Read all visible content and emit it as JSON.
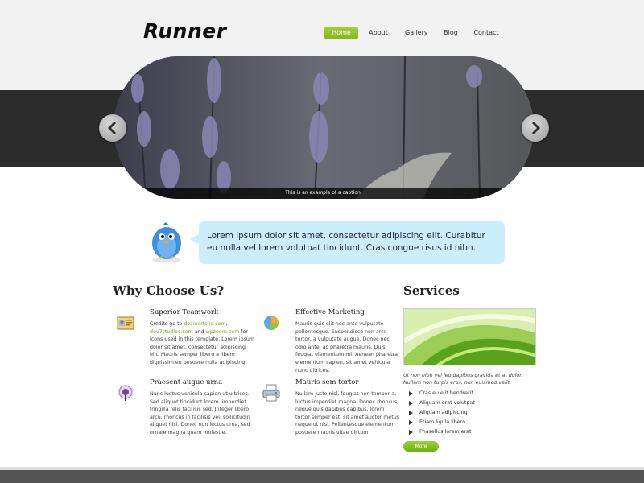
{
  "site": {
    "logo": "Runner"
  },
  "nav": {
    "home": "Home",
    "about": "About",
    "gallery": "Gallery",
    "blog": "Blog",
    "contact": "Contact"
  },
  "slider": {
    "caption": "This is an example of a caption."
  },
  "intro": {
    "text": "Lorem ipsum dolor sit amet, consectetur adipiscing elit. Curabitur eu nulla vel lorem volutpat tincidunt. Cras congue risus id nibh."
  },
  "why": {
    "heading": "Why Choose Us?",
    "features": [
      {
        "title": "Superior Teamwork",
        "body_pre": "Credits go to ",
        "link1": "dezinerfolio.com",
        "sep": ",",
        "link2": "dev7studios.com",
        "and": " and ",
        "link3": "wpzoom.com",
        "body_post": " for icons used in this template. Lorem ipsum dolor sit amet, consectetur adipiscing elit. Mauris semper libero a libero dignissim eu posuere nulla adipiscing."
      },
      {
        "title": "Effective Marketing",
        "body": "Mauris quis elit nec ante vulputate pellentesque. Suspendisse non arcu tortor, a vulputate augue. Donec nec odio ante, ac pharetra mauris. Duis feugiat elementum mi. Aenean pharetra elementum sapien, sit amet vehicula nunc ultrices."
      },
      {
        "title": "Praesent augue urna",
        "body": "Nunc luctus vehicula sapien ut ultrices. Sed aliquet tincidunt lorem, imperdiet fringilla felis facilisis sed. Integer libero arcu, rhoncus in facilisis vel, sollicitudin aliquet nisi. Donec non lectus urna, sed ornare magna quam molestie."
      },
      {
        "title": "Mauris sem tortor",
        "body": "Nullam justo nisl, feugiat non tempor a, luctus imperdiet magna. Donec rhoncus, neque quis dapibus dapibus, lorem tortor semper est, sit amet auctor metus neque ut nisl. Pellentesque elementum posuere mauris vitae dictum."
      }
    ]
  },
  "services": {
    "heading": "Services",
    "text": "Ut non nibh vel leo dapibus gravida et at dolor. Nullam non turpis eros, non euismod velit.",
    "items": [
      "Cras eu elit hendrerit",
      "Aliquam erat volutpat",
      "Aliquam adipiscing",
      "Etiam ligula libero",
      "Phasellus lorem erat"
    ],
    "more": "More"
  },
  "colors": {
    "accent": "#8cc63f",
    "bubble": "#ccedfc",
    "dark_band": "#2c2c2c"
  }
}
